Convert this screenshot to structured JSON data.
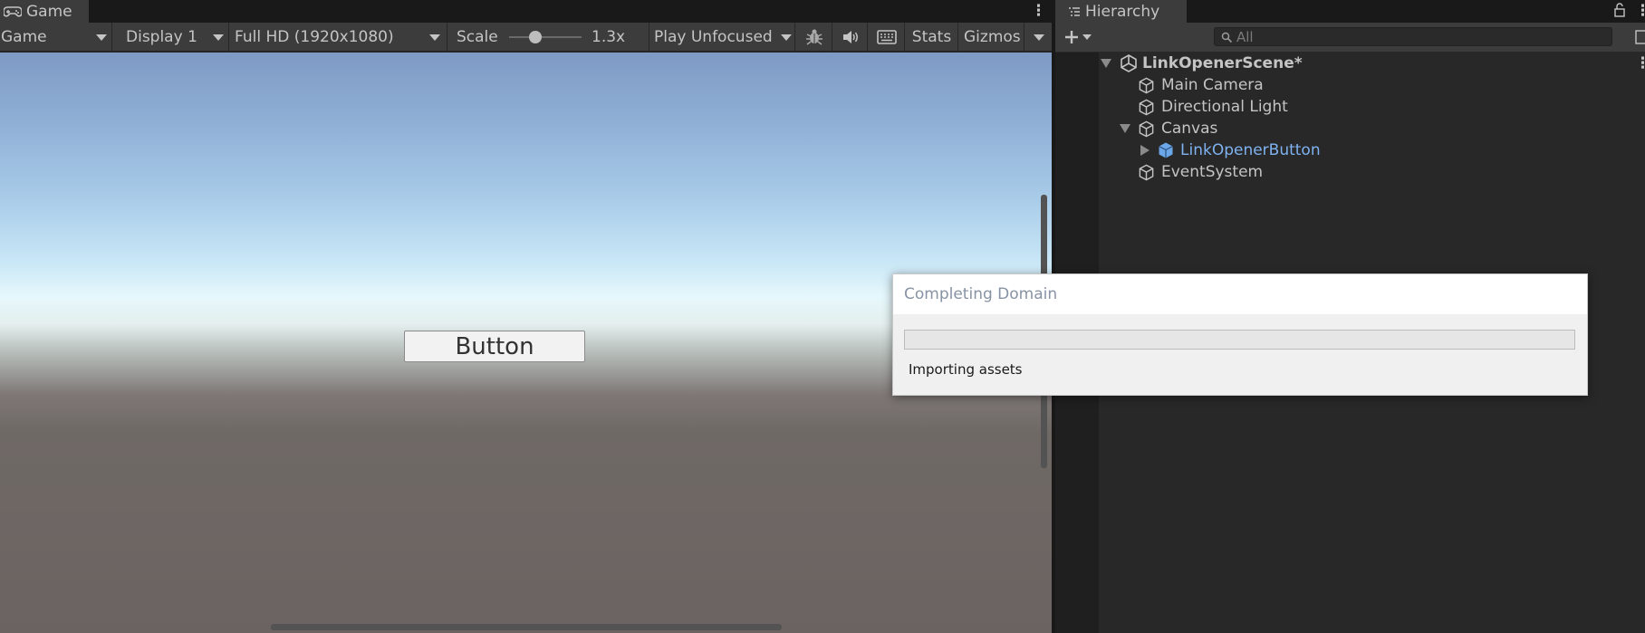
{
  "game": {
    "tab_label": "Game",
    "toolbar": {
      "mode_label": "Game",
      "display_label": "Display 1",
      "resolution_label": "Full HD (1920x1080)",
      "scale_label": "Scale",
      "scale_value": "1.3x",
      "play_mode_label": "Play Unfocused",
      "stats_label": "Stats",
      "gizmos_label": "Gizmos"
    },
    "viewport": {
      "button_label": "Button"
    }
  },
  "hierarchy": {
    "tab_label": "Hierarchy",
    "search_placeholder": "All",
    "scene_name": "LinkOpenerScene*",
    "items": [
      {
        "label": "Main Camera"
      },
      {
        "label": "Directional Light"
      },
      {
        "label": "Canvas"
      },
      {
        "label": "LinkOpenerButton"
      },
      {
        "label": "EventSystem"
      }
    ]
  },
  "dialog": {
    "title": "Completing Domain",
    "progress": 0,
    "status": "Importing assets"
  },
  "colors": {
    "selected_prefab_text": "#7fb2f0",
    "prefab_icon": "#6aa6e8",
    "progress_fill": "#06b025"
  },
  "icons": [
    "game-controller-icon",
    "menu-kebab-icon",
    "hierarchy-list-icon",
    "lock-icon",
    "plus-icon",
    "search-icon",
    "unity-scene-icon",
    "gameobject-cube-icon",
    "prefab-cube-icon",
    "bug-icon",
    "audio-icon",
    "keyboard-icon"
  ]
}
